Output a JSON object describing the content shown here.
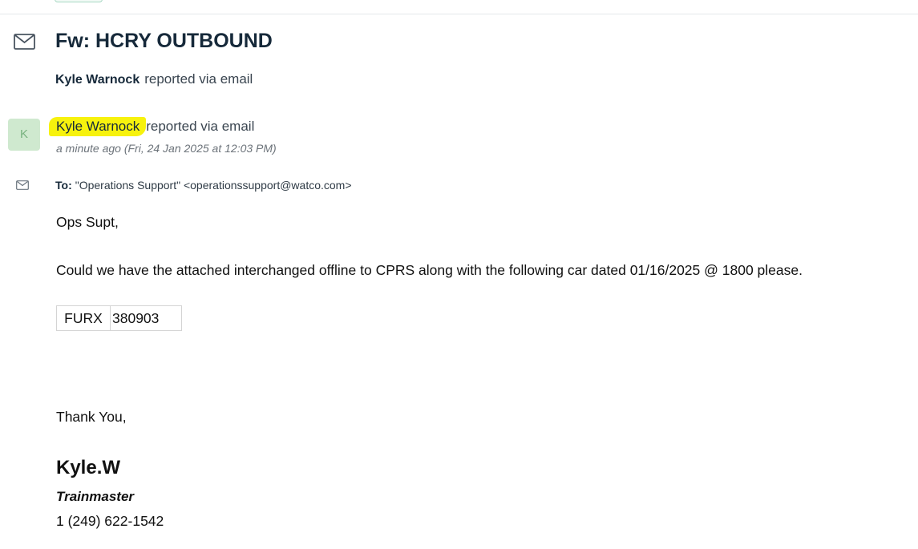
{
  "ticket": {
    "title": "Fw: HCRY OUTBOUND",
    "reporter_name": "Kyle Warnock",
    "reporter_suffix": "reported via email"
  },
  "conversation": {
    "avatar_initial": "K",
    "sender_name": "Kyle Warnock",
    "sender_suffix": "reported via email",
    "timestamp": "a minute ago (Fri, 24 Jan 2025 at 12:03 PM)",
    "to_label": "To:",
    "to_value": "\"Operations Support\" <operationssupport@watco.com>",
    "highlight_color": "#f7f20d"
  },
  "email": {
    "greeting": "Ops Supt,",
    "message": "Could we have the attached interchanged offline to CPRS along with the following car dated 01/16/2025 @ 1800 please.",
    "car_table": [
      {
        "mark": "FURX",
        "number": "380903"
      }
    ],
    "closing": "Thank You,",
    "signature": {
      "name": "Kyle.W",
      "title": "Trainmaster",
      "phone": "1 (249) 622-1542"
    }
  },
  "icons": {
    "ticket_type": "envelope-icon",
    "source": "envelope-icon"
  }
}
